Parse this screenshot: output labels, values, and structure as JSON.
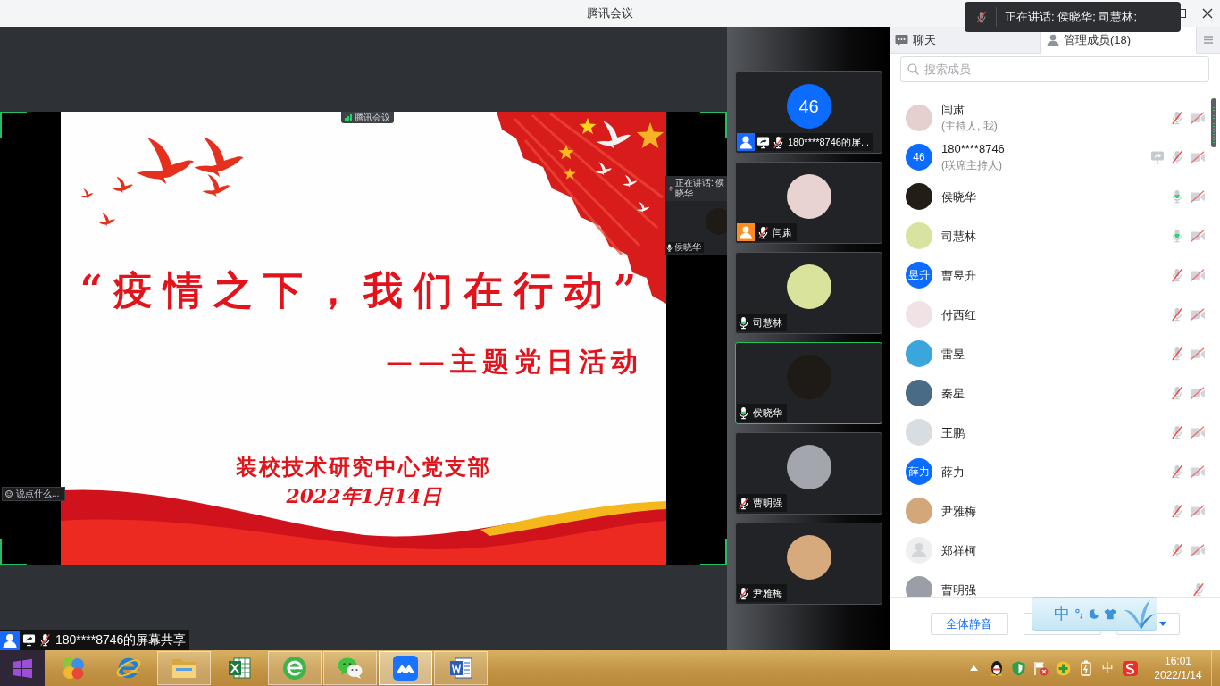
{
  "window": {
    "title": "腾讯会议"
  },
  "speaking_toast": {
    "mic_muted": true,
    "text": "正在讲话: 侯晓华; 司慧林;"
  },
  "shared_screen": {
    "app_tag": "腾讯会议",
    "slide": {
      "title": "“疫情之下，我们在行动”",
      "subtitle": "——主题党日活动",
      "organization": "装校技术研究中心党支部",
      "date": "2022年1月14日"
    },
    "mini_toast": {
      "mic_muted": true,
      "text": "正在讲话: 侯晓华"
    },
    "mini_tile": {
      "name": "侯晓华",
      "muted": false,
      "avatar": {
        "kind": "photo",
        "color": "#1e1a16"
      }
    },
    "chat_hint": "说点什么..."
  },
  "share_label": {
    "host": false,
    "cohost": true,
    "sharing": true,
    "muted": true,
    "text": "180****8746的屏幕共享"
  },
  "tiles": [
    {
      "name": "180****8746的屏...",
      "avatar": {
        "kind": "text",
        "text": "46"
      },
      "host": false,
      "cohost": true,
      "sharing": true,
      "muted": true,
      "speaking": false
    },
    {
      "name": "闫肃",
      "avatar": {
        "kind": "photo",
        "color": "#e8d3d0"
      },
      "host": true,
      "cohost": false,
      "sharing": false,
      "muted": true,
      "speaking": false
    },
    {
      "name": "司慧林",
      "avatar": {
        "kind": "photo",
        "color": "#d9e39c"
      },
      "host": false,
      "cohost": false,
      "sharing": false,
      "muted": false,
      "speaking": false
    },
    {
      "name": "侯晓华",
      "avatar": {
        "kind": "photo",
        "color": "#1e1a16"
      },
      "host": false,
      "cohost": false,
      "sharing": false,
      "muted": false,
      "speaking": true
    },
    {
      "name": "曹明强",
      "avatar": {
        "kind": "photo",
        "color": "#a3a6ad"
      },
      "host": false,
      "cohost": false,
      "sharing": false,
      "muted": true,
      "speaking": false
    },
    {
      "name": "尹雅梅",
      "avatar": {
        "kind": "photo",
        "color": "#d6aa7c"
      },
      "host": false,
      "cohost": false,
      "sharing": false,
      "muted": true,
      "speaking": false
    }
  ],
  "panel": {
    "tabs": [
      {
        "kind": "chat",
        "label": "聊天",
        "selected": false
      },
      {
        "kind": "members",
        "label": "管理成员(18)",
        "selected": true
      }
    ],
    "search": {
      "placeholder": "搜索成员"
    },
    "members": [
      {
        "name": "闫肃",
        "note": "(主持人, 我)",
        "avatar": {
          "kind": "photo",
          "color": "#e6cfcf"
        },
        "sharing": false,
        "muted": true,
        "camera_off": true
      },
      {
        "name": "180****8746",
        "note": "(联席主持人)",
        "avatar": {
          "kind": "text",
          "text": "46"
        },
        "sharing": true,
        "muted": true,
        "camera_off": true
      },
      {
        "name": "侯晓华",
        "avatar": {
          "kind": "photo",
          "color": "#231d18"
        },
        "sharing": false,
        "muted": false,
        "camera_off": true
      },
      {
        "name": "司慧林",
        "avatar": {
          "kind": "photo",
          "color": "#d9e3a0"
        },
        "sharing": false,
        "muted": false,
        "camera_off": true
      },
      {
        "name": "曹昱升",
        "avatar": {
          "kind": "text",
          "text": "昱升"
        },
        "sharing": false,
        "muted": true,
        "camera_off": true
      },
      {
        "name": "付西红",
        "avatar": {
          "kind": "photo",
          "color": "#f1e2e6"
        },
        "sharing": false,
        "muted": true,
        "camera_off": true
      },
      {
        "name": "雷昱",
        "avatar": {
          "kind": "photo",
          "color": "#3aa6dc"
        },
        "sharing": false,
        "muted": true,
        "camera_off": true
      },
      {
        "name": "秦星",
        "avatar": {
          "kind": "photo",
          "color": "#4a6b85"
        },
        "sharing": false,
        "muted": true,
        "camera_off": true
      },
      {
        "name": "王鹏",
        "avatar": {
          "kind": "photo",
          "color": "#d8dde2"
        },
        "sharing": false,
        "muted": true,
        "camera_off": true
      },
      {
        "name": "薛力",
        "avatar": {
          "kind": "text",
          "text": "薛力"
        },
        "sharing": false,
        "muted": true,
        "camera_off": true
      },
      {
        "name": "尹雅梅",
        "avatar": {
          "kind": "photo",
          "color": "#d4a77a"
        },
        "sharing": false,
        "muted": true,
        "camera_off": true
      },
      {
        "name": "郑祥柯",
        "avatar": {
          "kind": "default"
        },
        "sharing": false,
        "muted": true,
        "camera_off": true
      },
      {
        "name": "曹明强",
        "avatar": {
          "kind": "photo",
          "color": "#9a9ea6"
        },
        "sharing": false,
        "muted": true
      }
    ],
    "footer_buttons": [
      {
        "kind": "plain",
        "label": "全体静音"
      },
      {
        "kind": "plain"
      },
      {
        "kind": "dropdown"
      }
    ]
  },
  "ime_toolbar": {
    "mode": "中"
  },
  "taskbar": {
    "apps": [
      {
        "kind": "balls",
        "running": false,
        "selected": false
      },
      {
        "kind": "browser",
        "running": false,
        "selected": false
      },
      {
        "kind": "folder",
        "running": true,
        "selected": false
      },
      {
        "kind": "spreadsheet",
        "running": false,
        "selected": false
      },
      {
        "kind": "ring",
        "running": true,
        "selected": false
      },
      {
        "kind": "chat",
        "running": true,
        "selected": false
      },
      {
        "kind": "meeting",
        "running": true,
        "selected": true
      },
      {
        "kind": "document",
        "running": true,
        "selected": false
      }
    ],
    "tray": {
      "input_mode": "中",
      "time": "16:01",
      "date": "2022/1/14"
    }
  }
}
